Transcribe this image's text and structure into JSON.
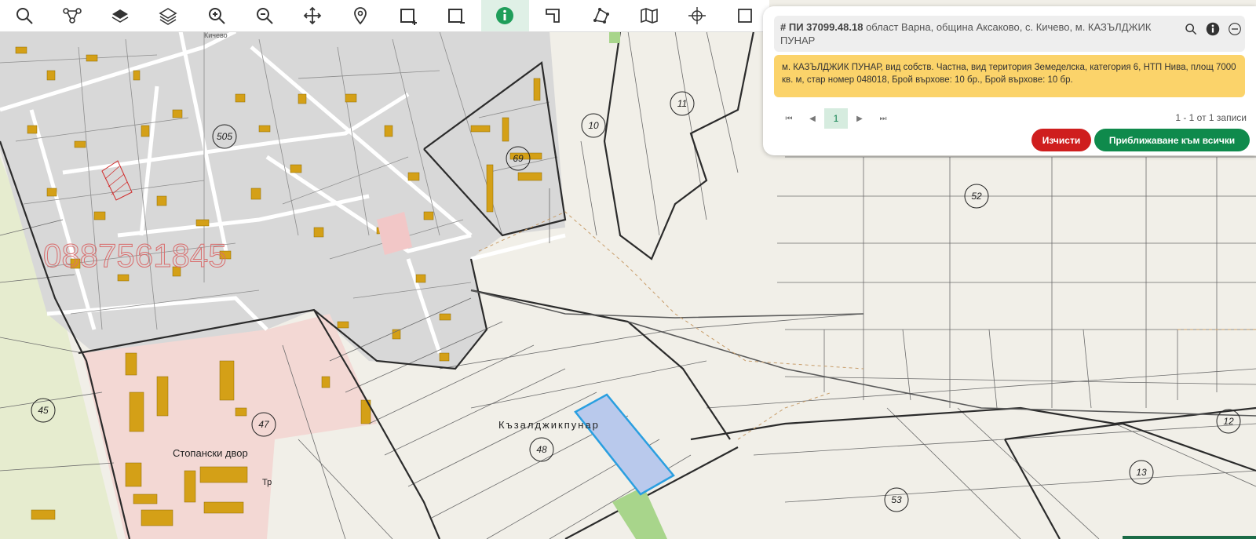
{
  "toolbar": {
    "tools": [
      "search-icon",
      "route-icon",
      "layers-icon",
      "layers-stack-icon",
      "zoom-in-icon",
      "zoom-out-icon",
      "pan-icon",
      "marker-icon",
      "select-add-icon",
      "select-remove-icon",
      "info-icon",
      "measure-icon",
      "polygon-icon",
      "map-icon",
      "crosshair-icon",
      "more-icon"
    ],
    "active_tool": "info-icon",
    "accent": "#1f9e5a"
  },
  "panel": {
    "parcel_id": "ПИ 37099.48.18",
    "location": "област Варна, община Аксаково, с. Кичево, м. КАЗЪЛДЖИК ПУНАР",
    "details": "м. КАЗЪЛДЖИК ПУНАР, вид собств. Частна, вид територия Земеделска, категория 6, НТП Нива, площ 7000 кв. м, стар номер 048018, Брой върхове: 10 бр., Брой върхове: 10 бр.",
    "pager": {
      "first": "⏮",
      "prev": "◀",
      "current": "1",
      "next": "▶",
      "last": "⏭"
    },
    "records": "1 - 1 от 1 записи",
    "clear_label": "Изчисти",
    "zoom_all_label": "Приближаване към всички",
    "head_icons": [
      "search-icon",
      "info-icon",
      "minimize-icon"
    ]
  },
  "map": {
    "watermark": "0887561845",
    "place_labels": {
      "locality": "Къзалджикпунар",
      "farmyard": "Стопански двор",
      "tr": "Тр",
      "road_label": "Кичево"
    },
    "numbers": [
      "505",
      "69",
      "11",
      "10",
      "52",
      "45",
      "47",
      "48",
      "53",
      "12",
      "13"
    ],
    "colors": {
      "background": "#f1efe8",
      "village": "#d9d9d9",
      "buildings": "#d4a017",
      "farmyard": "#f4d6d2",
      "selected_fill": "#b9c9ec",
      "selected_stroke": "#2a9fe0",
      "green_strip": "#a8d58b"
    }
  }
}
